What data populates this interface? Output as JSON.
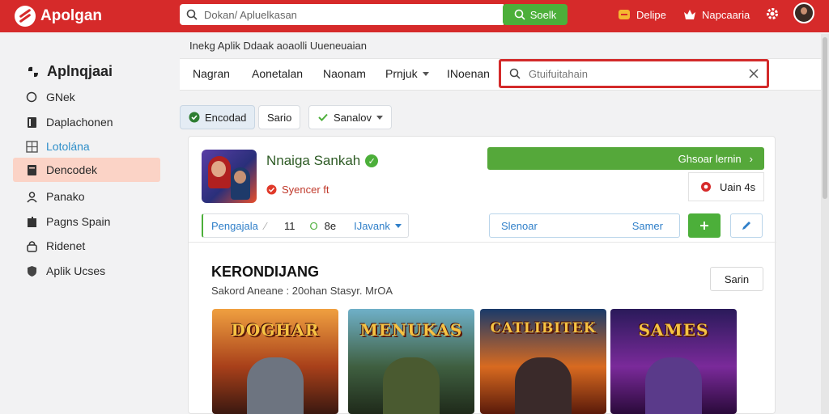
{
  "header": {
    "brand": "Apolgan",
    "search_placeholder": "Dokan/ Apluelkasan",
    "search_button": "Soelk",
    "action1": "Delipe",
    "action2": "Napcaaria"
  },
  "sidebar": {
    "title": "Aplnqjaai",
    "items": [
      {
        "label": "GNek",
        "icon": "search-icon"
      },
      {
        "label": "Daplachonen",
        "icon": "book-icon"
      },
      {
        "label": "Lotolána",
        "icon": "grid-icon"
      },
      {
        "label": "Dencodek",
        "icon": "library-icon"
      },
      {
        "label": "Panako",
        "icon": "user-icon"
      },
      {
        "label": "Pagns Spain",
        "icon": "puzzle-icon"
      },
      {
        "label": "Ridenet",
        "icon": "lock-icon"
      },
      {
        "label": "Aplik Ucses",
        "icon": "shield-icon"
      }
    ]
  },
  "main": {
    "subheader": "Inekg Aplik Ddaak aoaolli Uueneuaian",
    "tabs": [
      {
        "label": "Nagran"
      },
      {
        "label": "Aonetalan"
      },
      {
        "label": "Naonam"
      },
      {
        "label": "Prnjuk"
      },
      {
        "label": "INoenan"
      }
    ],
    "tab_search_placeholder": "Gtuifuitahain",
    "chips": [
      "Encodad",
      "Sario",
      "Sanalov"
    ]
  },
  "app": {
    "title": "Nnaiga Sankah",
    "subtitle": "Syencer ft",
    "install_label": "Ghsoar lernin",
    "rating_label": "Uain 4s",
    "info_left": "Pengajala",
    "info_num": "11",
    "info_size": "8e",
    "info_link": "IJavank",
    "field_left": "Slenoar",
    "field_right": "Samer"
  },
  "section": {
    "title": "KERONDIJANG",
    "meta": "Sakord Aneane : 20ohan Stasyr.  MrOA",
    "see_all": "Sarin",
    "games": [
      {
        "title": "DOGHAR"
      },
      {
        "title": "MENUKAS"
      },
      {
        "title": "CATLIBITEK"
      },
      {
        "title": "SAMES"
      }
    ]
  },
  "colors": {
    "brand_red": "#d62a2a",
    "accent_green": "#4caf3a",
    "link_blue": "#2f7fc9",
    "active_item_bg": "#fbd3c6"
  }
}
